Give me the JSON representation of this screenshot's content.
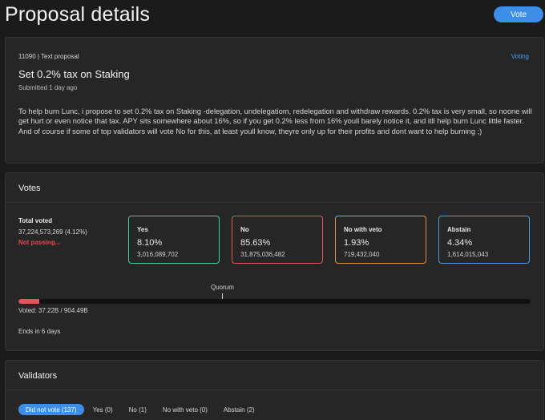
{
  "header": {
    "title": "Proposal details",
    "vote_button": "Vote"
  },
  "proposal": {
    "meta": "11090 | Text proposal",
    "status": "Voting",
    "title": "Set 0.2% tax on Staking",
    "submitted": "Submitted 1 day ago",
    "description": "To help burn Lunc, i propose to set 0.2% tax on Staking -delegation, undelegatiom, redelegation and withdraw rewards. 0.2% tax is very small, so noone will get hurt or even notice that tax. APY sits somewhere about 16%, so if you get 0.2% less from 16% youll barely notice it, and itll help burn Lunc little faster. And of course if some of top validators will vote No for this, at least youll know, theyre only up for their profits and dont want to help burning ;)"
  },
  "votes": {
    "section_title": "Votes",
    "total_label": "Total voted",
    "total_value": "37,224,573,269 (4.12%)",
    "passing_status": "Not passing...",
    "options": [
      {
        "label": "Yes",
        "percent": "8.10%",
        "amount": "3,016,089,702",
        "color": "#3ecfa0"
      },
      {
        "label": "No",
        "percent": "85.63%",
        "amount": "31,875,036,482",
        "color": "#e4545a"
      },
      {
        "label": "No with veto",
        "percent": "1.93%",
        "amount": "719,432,040",
        "color": "#e58f3c"
      },
      {
        "label": "Abstain",
        "percent": "4.34%",
        "amount": "1,614,015,043",
        "color": "#4a9fe8"
      }
    ],
    "quorum_label": "Quorum",
    "voted_fraction": 0.0412,
    "voted_text": "Voted: 37.22B / 904.49B",
    "ends_text": "Ends in 6 days"
  },
  "validators": {
    "section_title": "Validators",
    "tabs": [
      {
        "label": "Did not vote (137)",
        "active": true
      },
      {
        "label": "Yes (0)",
        "active": false
      },
      {
        "label": "No (1)",
        "active": false
      },
      {
        "label": "No with veto (0)",
        "active": false
      },
      {
        "label": "Abstain (2)",
        "active": false
      }
    ]
  },
  "colors": {
    "accent": "#3d8ee8",
    "not_passing": "#e4454d",
    "background": "#1b1b1c",
    "card": "#262627"
  }
}
